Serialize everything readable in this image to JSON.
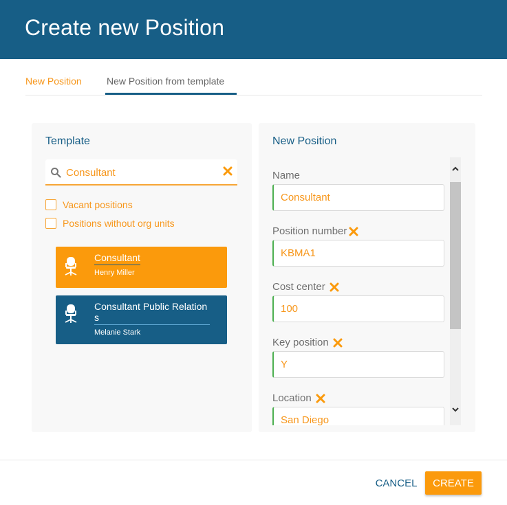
{
  "dialog": {
    "title": "Create new Position"
  },
  "tabs": [
    {
      "label": "New Position",
      "active": false
    },
    {
      "label": "New Position from template",
      "active": true
    }
  ],
  "template_panel": {
    "title": "Template",
    "search": {
      "value": "Consultant",
      "placeholder": ""
    },
    "filters": [
      {
        "label": "Vacant positions",
        "checked": false
      },
      {
        "label": "Positions without org units",
        "checked": false
      }
    ],
    "results": [
      {
        "title": "Consultant",
        "subtitle": "Henry Miller",
        "selected": true
      },
      {
        "title": "Consultant Public Relations",
        "subtitle": "Melanie Stark",
        "selected": false
      }
    ]
  },
  "new_position_panel": {
    "title": "New Position",
    "fields": [
      {
        "label": "Name",
        "value": "Consultant",
        "removable": false
      },
      {
        "label": "Position number",
        "value": "KBMA1",
        "removable": true
      },
      {
        "label": "Cost center",
        "value": "100",
        "removable": true
      },
      {
        "label": "Key position",
        "value": "Y",
        "removable": true
      },
      {
        "label": "Location",
        "value": "San Diego",
        "removable": true
      }
    ]
  },
  "footer": {
    "cancel_label": "CANCEL",
    "create_label": "CREATE"
  },
  "colors": {
    "primary": "#175e86",
    "accent": "#fb9a0c",
    "valid": "#4caf50"
  }
}
